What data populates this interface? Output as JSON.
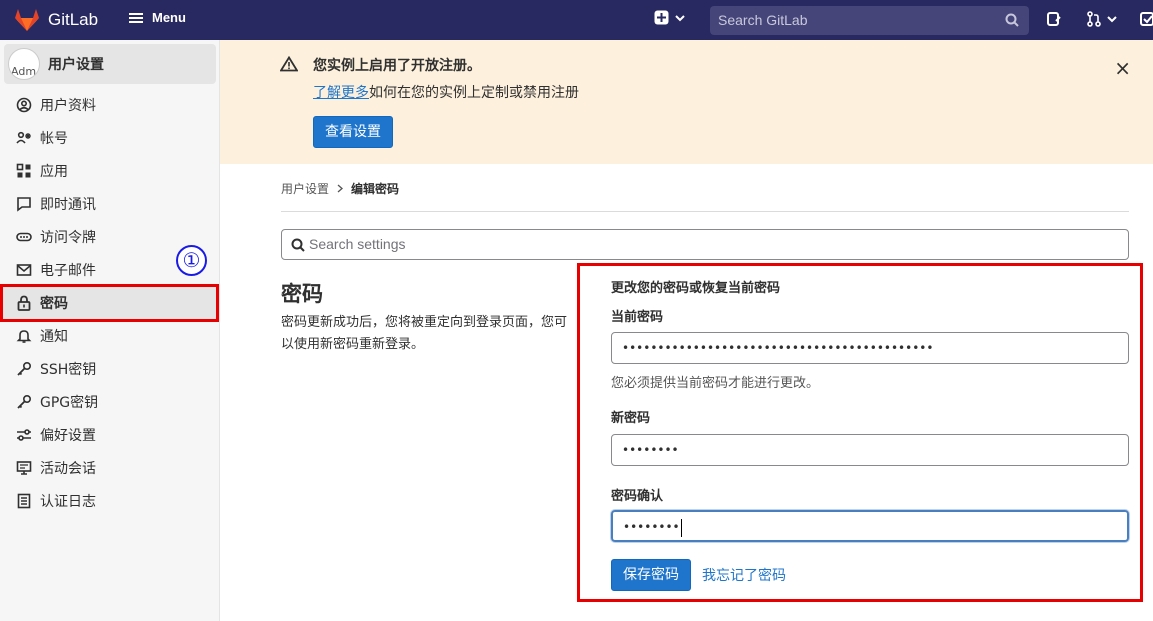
{
  "topbar": {
    "logo_text": "GitLab",
    "menu_label": "Menu",
    "search_placeholder": "Search GitLab",
    "colors": {
      "background": "#292961",
      "logo": "#e24329"
    }
  },
  "sidebar": {
    "header_title": "用户设置",
    "avatar_alt": "Adm",
    "items": [
      {
        "label": "用户资料",
        "icon": "profile-icon"
      },
      {
        "label": "帐号",
        "icon": "account-icon"
      },
      {
        "label": "应用",
        "icon": "applications-icon"
      },
      {
        "label": "即时通讯",
        "icon": "chat-icon"
      },
      {
        "label": "访问令牌",
        "icon": "token-icon"
      },
      {
        "label": "电子邮件",
        "icon": "mail-icon"
      },
      {
        "label": "密码",
        "icon": "lock-icon",
        "active": true
      },
      {
        "label": "通知",
        "icon": "bell-icon"
      },
      {
        "label": "SSH密钥",
        "icon": "key-icon"
      },
      {
        "label": "GPG密钥",
        "icon": "key-icon"
      },
      {
        "label": "偏好设置",
        "icon": "preferences-icon"
      },
      {
        "label": "活动会话",
        "icon": "monitor-icon"
      },
      {
        "label": "认证日志",
        "icon": "log-icon"
      }
    ],
    "annotation_number": "①"
  },
  "alert": {
    "title": "您实例上启用了开放注册。",
    "link_text": "了解更多",
    "body_text": "如何在您的实例上定制或禁用注册",
    "button_label": "查看设置",
    "close_symbol": "×"
  },
  "breadcrumb": {
    "parent": "用户设置",
    "current": "编辑密码"
  },
  "settings_search": {
    "placeholder": "Search settings"
  },
  "section": {
    "title": "密码",
    "description": "密码更新成功后，您将被重定向到登录页面，您可以使用新密码重新登录。"
  },
  "form": {
    "heading": "更改您的密码或恢复当前密码",
    "current_label": "当前密码",
    "current_value": "••••••••••••••••••••••••••••••••••••••••••••",
    "current_hint": "您必须提供当前密码才能进行更改。",
    "new_label": "新密码",
    "new_value": "••••••••",
    "confirm_label": "密码确认",
    "confirm_value": "••••••••",
    "save_label": "保存密码",
    "forgot_label": "我忘记了密码"
  }
}
